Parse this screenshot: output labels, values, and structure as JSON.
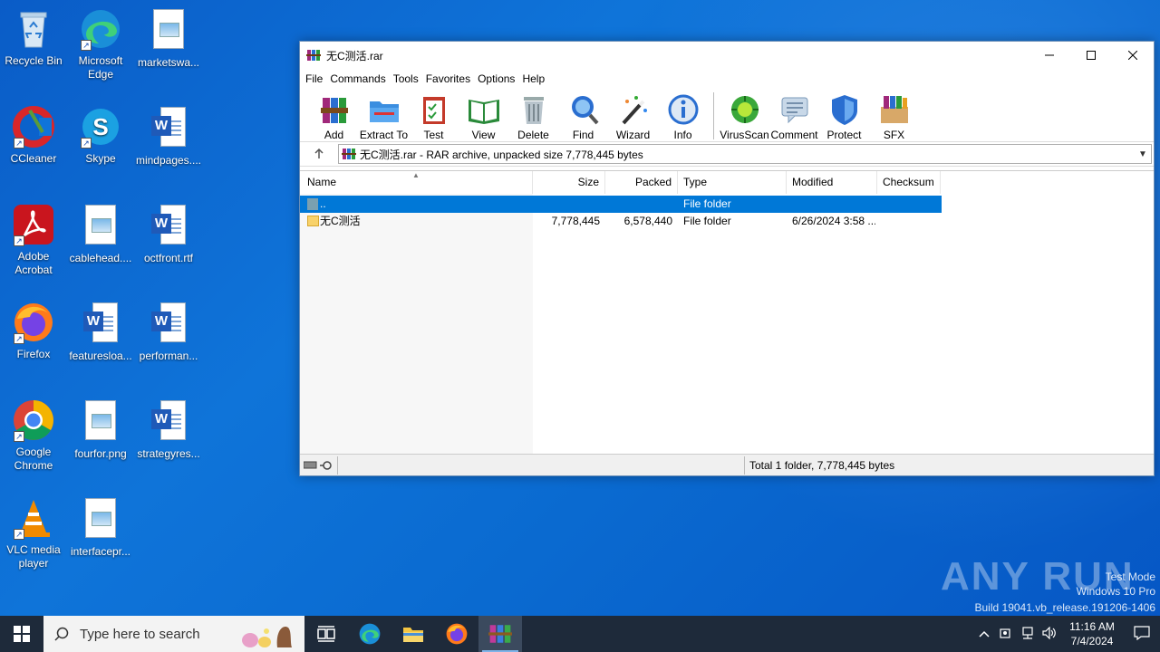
{
  "desktop": {
    "icons": [
      {
        "label": "Recycle Bin"
      },
      {
        "label": "Microsoft Edge"
      },
      {
        "label": "marketswa..."
      },
      {
        "label": "CCleaner"
      },
      {
        "label": "Skype"
      },
      {
        "label": "mindpages...."
      },
      {
        "label": "Adobe Acrobat"
      },
      {
        "label": "cablehead...."
      },
      {
        "label": "octfront.rtf"
      },
      {
        "label": "Firefox"
      },
      {
        "label": "featuresloa..."
      },
      {
        "label": "performan..."
      },
      {
        "label": "Google Chrome"
      },
      {
        "label": "fourfor.png"
      },
      {
        "label": "strategyres..."
      },
      {
        "label": "VLC media player"
      },
      {
        "label": "interfacepr..."
      }
    ]
  },
  "window": {
    "title": "无C测活.rar",
    "menu": [
      "File",
      "Commands",
      "Tools",
      "Favorites",
      "Options",
      "Help"
    ],
    "toolbar": [
      "Add",
      "Extract To",
      "Test",
      "View",
      "Delete",
      "Find",
      "Wizard",
      "Info",
      "VirusScan",
      "Comment",
      "Protect",
      "SFX"
    ],
    "address": "无C测活.rar - RAR archive, unpacked size 7,778,445 bytes",
    "columns": [
      "Name",
      "Size",
      "Packed",
      "Type",
      "Modified",
      "Checksum"
    ],
    "rows": [
      {
        "name": "..",
        "size": "",
        "packed": "",
        "type": "File folder",
        "modified": "",
        "checksum": ""
      },
      {
        "name": "无C测活",
        "size": "7,778,445",
        "packed": "6,578,440",
        "type": "File folder",
        "modified": "6/26/2024 3:58 ...",
        "checksum": ""
      }
    ],
    "status": "Total 1 folder, 7,778,445 bytes"
  },
  "watermark": {
    "brand": "ANY RUN",
    "line1": "Test Mode",
    "line2": "Windows 10 Pro",
    "line3": "Build 19041.vb_release.191206-1406"
  },
  "taskbar": {
    "search_placeholder": "Type here to search",
    "time": "11:16 AM",
    "date": "7/4/2024"
  },
  "colors": {
    "selection": "#0078d7",
    "taskbar": "#1e2a3a",
    "desktop": "#0f74d9"
  }
}
